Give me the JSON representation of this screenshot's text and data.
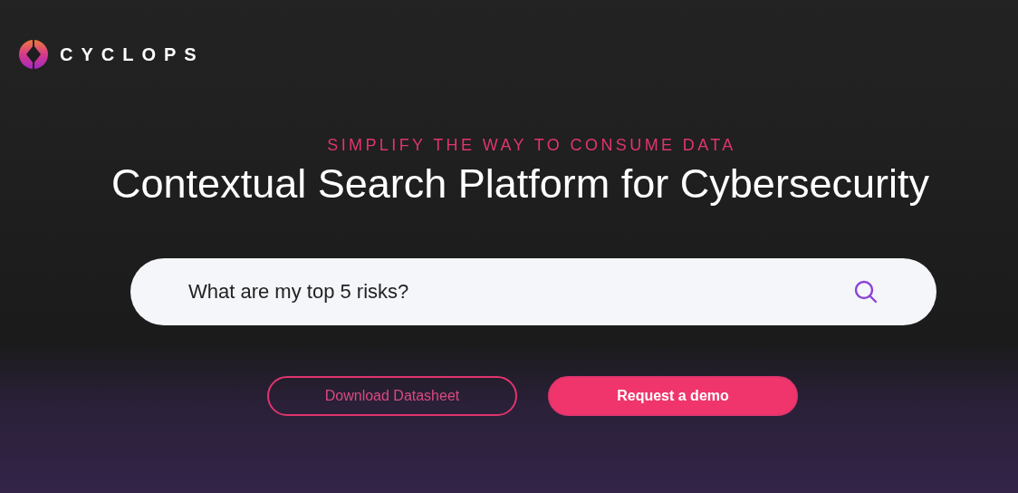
{
  "brand": {
    "name": "CYCLOPS"
  },
  "hero": {
    "tagline": "SIMPLIFY THE WAY TO CONSUME DATA",
    "heading": "Contextual Search Platform for Cybersecurity"
  },
  "search": {
    "value": "What are my top 5 risks?"
  },
  "buttons": [
    {
      "label": "Download Datasheet",
      "kind": "outline"
    },
    {
      "label": "Request a demo",
      "kind": "filled"
    }
  ]
}
